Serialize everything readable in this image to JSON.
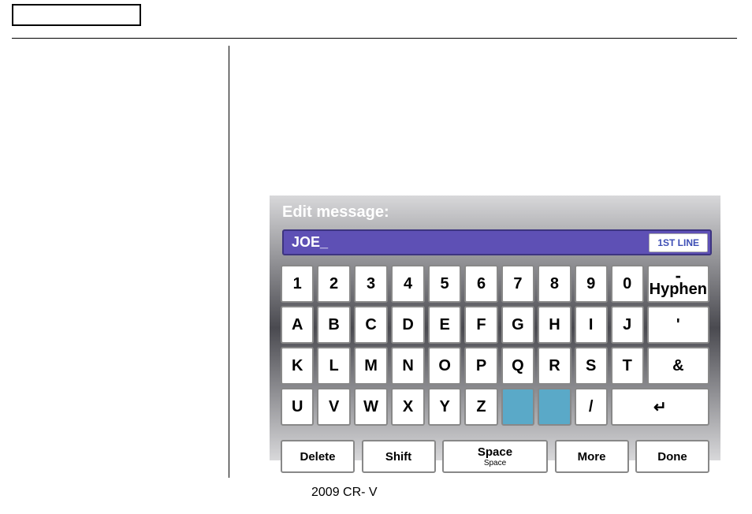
{
  "panel": {
    "title": "Edit message:",
    "input_value": "JOE_",
    "line_badge": "1ST LINE"
  },
  "keys": {
    "r1": [
      "1",
      "2",
      "3",
      "4",
      "5",
      "6",
      "7",
      "8",
      "9",
      "0"
    ],
    "hyphen_dash": "-",
    "hyphen_label": "Hyphen",
    "r2": [
      "A",
      "B",
      "C",
      "D",
      "E",
      "F",
      "G",
      "H",
      "I",
      "J"
    ],
    "apostrophe": "'",
    "r3": [
      "K",
      "L",
      "M",
      "N",
      "O",
      "P",
      "Q",
      "R",
      "S",
      "T"
    ],
    "ampersand": "&",
    "r4": [
      "U",
      "V",
      "W",
      "X",
      "Y",
      "Z"
    ],
    "slash": "/",
    "enter": "↵"
  },
  "bottom": {
    "delete": "Delete",
    "shift": "Shift",
    "space": "Space",
    "space_sub": "Space",
    "more": "More",
    "done": "Done"
  },
  "footer": "2009  CR- V"
}
